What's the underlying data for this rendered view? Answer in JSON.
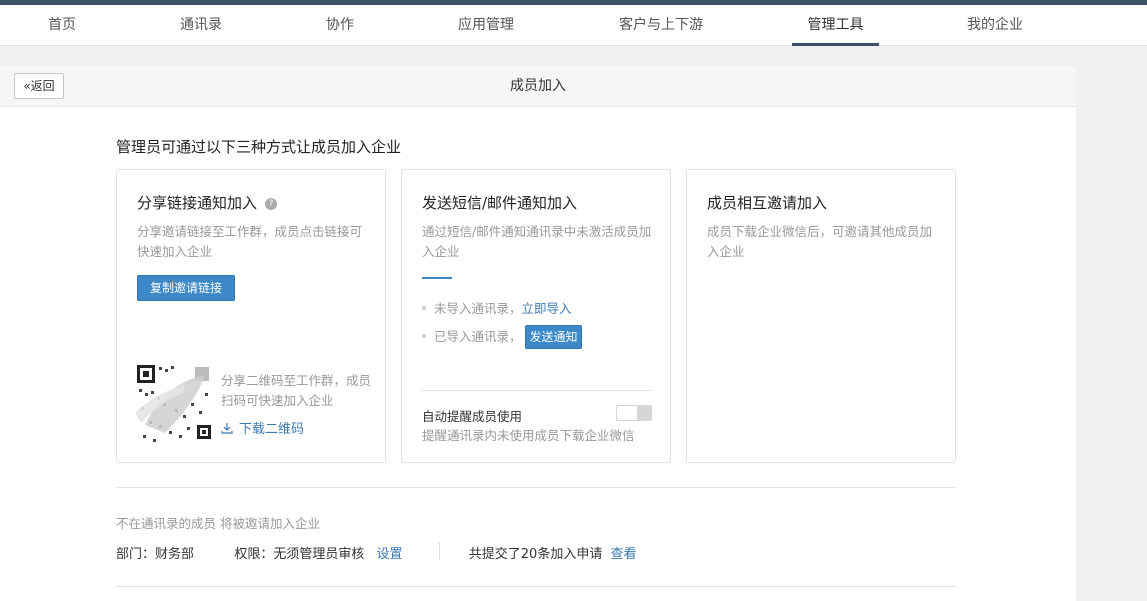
{
  "nav": {
    "items": [
      {
        "label": "首页",
        "active": false
      },
      {
        "label": "通讯录",
        "active": false
      },
      {
        "label": "协作",
        "active": false
      },
      {
        "label": "应用管理",
        "active": false
      },
      {
        "label": "客户与上下游",
        "active": false
      },
      {
        "label": "管理工具",
        "active": true
      },
      {
        "label": "我的企业",
        "active": false
      }
    ]
  },
  "header": {
    "back_label": "«返回",
    "title": "成员加入"
  },
  "main": {
    "headline": "管理员可通过以下三种方式让成员加入企业",
    "card_link": {
      "title": "分享链接通知加入",
      "help_icon": "question-circle-icon",
      "desc": "分享邀请链接至工作群，成员点击链接可快速加入企业",
      "copy_button": "复制邀请链接",
      "qr_desc": "分享二维码至工作群，成员扫码可快速加入企业",
      "download_label": "下载二维码",
      "download_icon": "download-icon"
    },
    "card_sms": {
      "title": "发送短信/邮件通知加入",
      "desc": "通过短信/邮件通知通讯录中未激活成员加入企业",
      "row1_text": "未导入通讯录，",
      "row1_link": "立即导入",
      "row2_text": "已导入通讯录，",
      "row2_button": "发送通知",
      "auto_label": "自动提醒成员使用",
      "auto_desc": "提醒通讯录内未使用成员下载企业微信",
      "toggle_on": false
    },
    "card_invite": {
      "title": "成员相互邀请加入",
      "desc": "成员下载企业微信后，可邀请其他成员加入企业"
    },
    "footer": {
      "note": "不在通讯录的成员 将被邀请加入企业",
      "dept_label": "部门：",
      "dept_value": "财务部",
      "perm_label": "权限：",
      "perm_value": "无须管理员审核",
      "perm_link": "设置",
      "apply_text": "共提交了20条加入申请",
      "apply_link": "查看"
    }
  },
  "colors": {
    "accent": "#3c88c8",
    "topbar": "#3d5066",
    "link": "#3c7ab5"
  }
}
